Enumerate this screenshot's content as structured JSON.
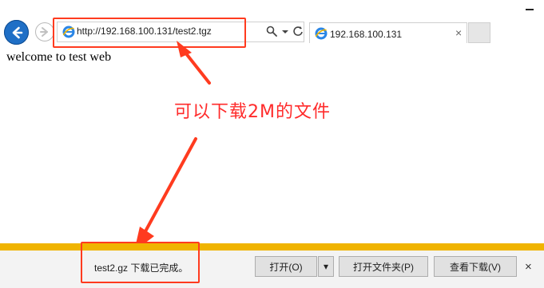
{
  "browser": {
    "address_url": "http://192.168.100.131/test2.tgz",
    "tab_title": "192.168.100.131",
    "icons": {
      "back": "back-arrow-icon",
      "forward": "forward-arrow-icon",
      "ie_logo": "ie-logo-icon",
      "search": "search-icon",
      "dropdown": "chevron-down-icon",
      "refresh": "refresh-icon",
      "close": "close-icon",
      "minimize": "minimize-icon"
    },
    "colors": {
      "accent_blue": "#1f6fc6",
      "annotation_red": "#ff3b1f",
      "download_bar_gold": "#f0b400"
    }
  },
  "page": {
    "text": "welcome to test web"
  },
  "annotation": {
    "text": "可以下载2M的文件"
  },
  "download_bar": {
    "message": "test2.gz 下载已完成。",
    "buttons": {
      "open": "打开(O)",
      "open_dropdown": "▾",
      "open_folder": "打开文件夹(P)",
      "view_downloads": "查看下载(V)",
      "close": "×"
    }
  },
  "ui_glyphs": {
    "tab_close": "×"
  }
}
